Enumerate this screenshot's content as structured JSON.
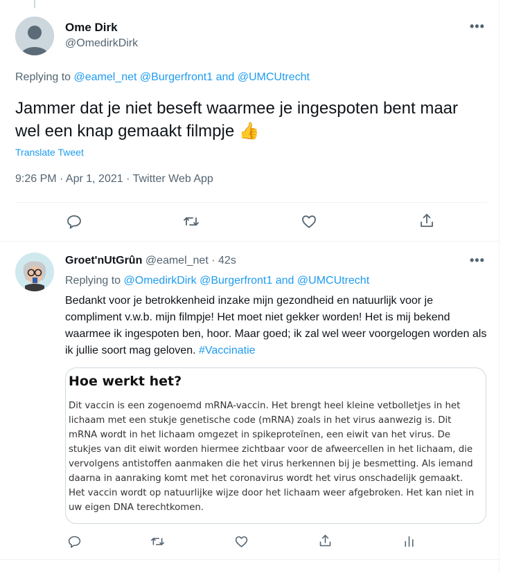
{
  "main_tweet": {
    "display_name": "Ome Dirk",
    "handle": "@OmedirkDirk",
    "replying_prefix": "Replying to",
    "reply_handle_1": "@eamel_net",
    "reply_handle_2": "@Burgerfront1",
    "reply_and": "and",
    "reply_handle_3": "@UMCUtrecht",
    "text": "Jammer dat je niet beseft waarmee je ingespoten bent maar wel een knap gemaakt filmpje",
    "emoji": "👍",
    "translate_label": "Translate Tweet",
    "timestamp": "9:26 PM · Apr 1, 2021 · Twitter Web App",
    "more_label": "•••"
  },
  "reply_tweet": {
    "display_name": "Groet'nUtGrûn",
    "handle": "@eamel_net",
    "separator": "·",
    "time_ago": "42s",
    "replying_prefix": "Replying to",
    "reply_handle_1": "@OmedirkDirk",
    "reply_handle_2": "@Burgerfront1",
    "reply_and": "and",
    "reply_handle_3": "@UMCUtrecht",
    "text": "Bedankt voor je betrokkenheid inzake mijn gezondheid en natuurlijk voor je compliment v.w.b. mijn filmpje! Het moet niet gekker worden! Het is mij bekend waarmee ik ingespoten ben, hoor. Maar goed; ik zal wel weer voorgelogen worden als ik jullie soort mag geloven.",
    "hashtag": "#Vaccinatie",
    "more_label": "•••",
    "card": {
      "title": "Hoe werkt het?",
      "body": "Dit vaccin is een zogenoemd mRNA-vaccin. Het brengt heel kleine vetbolletjes in het lichaam met een stukje genetische code (mRNA) zoals in het virus aanwezig is. Dit mRNA wordt in het lichaam omgezet in spikeproteïnen, een eiwit van het virus. De stukjes van dit eiwit worden hiermee zichtbaar voor de afweercellen in het lichaam, die vervolgens antistoffen aanmaken die het virus herkennen bij je besmetting. Als iemand daarna in aanraking komt met het coronavirus wordt het virus onschadelijk gemaakt. Het vaccin wordt op natuurlijke wijze door het lichaam weer afgebroken. Het kan niet in uw eigen DNA terechtkomen."
    }
  },
  "icons": {
    "reply": "reply-icon",
    "retweet": "retweet-icon",
    "like": "heart-icon",
    "share": "share-icon",
    "analytics": "analytics-icon",
    "more": "more-icon"
  },
  "colors": {
    "link": "#1d9bf0",
    "secondary_text": "#536471",
    "primary_text": "#0f1419",
    "divider": "#eff3f4"
  }
}
